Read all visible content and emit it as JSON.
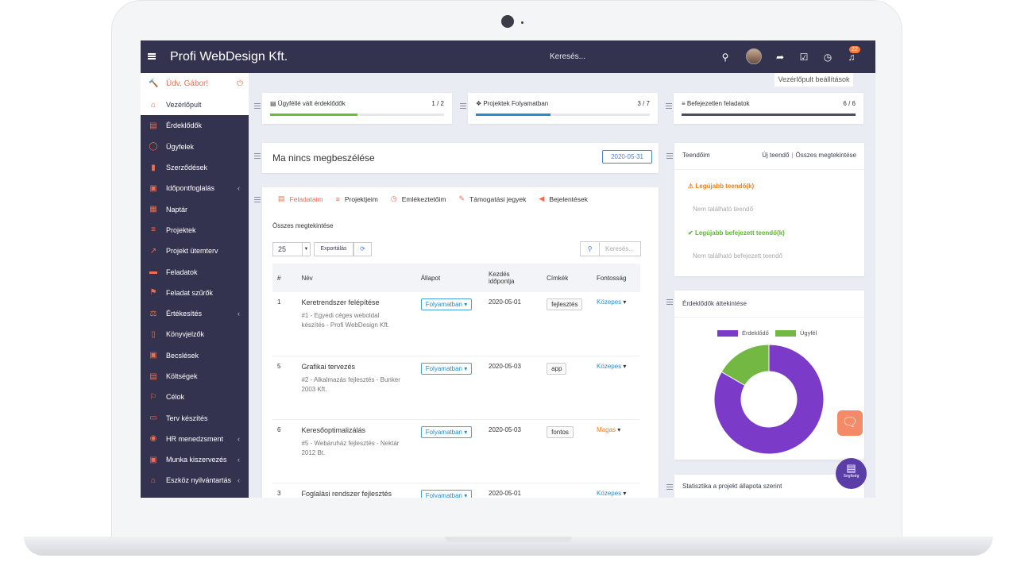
{
  "header": {
    "brand": "Profi WebDesign Kft.",
    "search_placeholder": "Keresés...",
    "notification_count": "22"
  },
  "sidebar": {
    "welcome": "Üdv, Gábor!",
    "items": [
      {
        "label": "Vezérlőpult",
        "icon": "home-icon",
        "glyph": "⌂",
        "active": true,
        "caret": false
      },
      {
        "label": "Érdeklődők",
        "icon": "store-icon",
        "glyph": "▤",
        "caret": false
      },
      {
        "label": "Ügyfelek",
        "icon": "user-icon",
        "glyph": "◯",
        "caret": false
      },
      {
        "label": "Szerződések",
        "icon": "document-icon",
        "glyph": "▮",
        "caret": false
      },
      {
        "label": "Időpontfoglalás",
        "icon": "calendar-check-icon",
        "glyph": "▣",
        "caret": true
      },
      {
        "label": "Naptár",
        "icon": "calendar-icon",
        "glyph": "▦",
        "caret": false
      },
      {
        "label": "Projektek",
        "icon": "list-icon",
        "glyph": "≡",
        "caret": false
      },
      {
        "label": "Projekt ütemterv",
        "icon": "line-chart-icon",
        "glyph": "↗",
        "caret": false
      },
      {
        "label": "Feladatok",
        "icon": "tasks-icon",
        "glyph": "▬",
        "caret": false
      },
      {
        "label": "Feladat szűrők",
        "icon": "filter-flag-icon",
        "glyph": "⚑",
        "caret": false
      },
      {
        "label": "Értékesítés",
        "icon": "balance-scale-icon",
        "glyph": "⚖",
        "caret": true
      },
      {
        "label": "Könyvjelzők",
        "icon": "bookmark-icon",
        "glyph": "▯",
        "caret": false
      },
      {
        "label": "Becslések",
        "icon": "estimate-icon",
        "glyph": "▣",
        "caret": false
      },
      {
        "label": "Költségek",
        "icon": "receipt-icon",
        "glyph": "▤",
        "caret": false
      },
      {
        "label": "Célok",
        "icon": "flag-icon",
        "glyph": "⚐",
        "caret": false
      },
      {
        "label": "Terv készítés",
        "icon": "id-card-icon",
        "glyph": "▭",
        "caret": false
      },
      {
        "label": "HR menedzsment",
        "icon": "person-circle-icon",
        "glyph": "◉",
        "caret": true
      },
      {
        "label": "Munka kiszervezés",
        "icon": "calendar-plus-icon",
        "glyph": "▣",
        "caret": true
      },
      {
        "label": "Eszköz nyilvántartás",
        "icon": "bank-icon",
        "glyph": "⌂",
        "caret": true
      }
    ]
  },
  "dashboard_settings_label": "Vezérlőpult beállítások",
  "stats": [
    {
      "title": "Ügyféllé vált érdeklődők",
      "count": "1 / 2",
      "progress": 0.5,
      "color": "#6cbb3c"
    },
    {
      "title": "Projektek Folyamatban",
      "count": "3 / 7",
      "progress": 0.43,
      "color": "#2a8acb"
    },
    {
      "title": "Befejezetlen feladatok",
      "count": "6 / 6",
      "progress": 1.0,
      "color": "#4a4d5e"
    }
  ],
  "meetings": {
    "title": "Ma nincs megbeszélése",
    "date": "2020-05-31"
  },
  "tasks": {
    "tabs": [
      {
        "label": "Feladataim",
        "icon": "tasks-icon",
        "glyph": "▤",
        "active": true
      },
      {
        "label": "Projektjeim",
        "icon": "list-icon",
        "glyph": "≡",
        "active": false
      },
      {
        "label": "Emlékeztetőim",
        "icon": "clock-icon",
        "glyph": "◷",
        "active": false
      },
      {
        "label": "Támogatási jegyek",
        "icon": "ticket-icon",
        "glyph": "✎",
        "active": false
      },
      {
        "label": "Bejelentések",
        "icon": "megaphone-icon",
        "glyph": "◀",
        "active": false
      }
    ],
    "view_all": "Összes megtekintése",
    "page_size": "25",
    "export_label": "Exportálás",
    "search_placeholder": "Keresés...",
    "columns": [
      "#",
      "Név",
      "Állapot",
      "Kezdés időpontja",
      "Címkék",
      "Fontosság"
    ],
    "rows": [
      {
        "id": "1",
        "name": "Keretrendszer felépítése",
        "desc": "#1 - Egyedi céges weboldal készítés - Profi WebDesign Kft.",
        "status": "Folyamatban",
        "start": "2020-05-01",
        "tag": "fejlesztés",
        "priority": "Közepes",
        "priority_color": "#2a8acb"
      },
      {
        "id": "5",
        "name": "Grafikai tervezés",
        "desc": "#2 - Alkalmazás fejlesztés - Bunker 2003 Kft.",
        "status": "Folyamatban",
        "start": "2020-05-03",
        "tag": "app",
        "priority": "Közepes",
        "priority_color": "#2a8acb"
      },
      {
        "id": "6",
        "name": "Keresőoptimalizálás",
        "desc": "#5 - Webáruház fejlesztés - Nektár 2012 Bt.",
        "status": "Folyamatban",
        "start": "2020-05-03",
        "tag": "fontos",
        "priority": "Magas",
        "priority_color": "#f07f1e"
      },
      {
        "id": "3",
        "name": "Foglalási rendszer fejlesztés",
        "desc": "",
        "status": "Folyamatban",
        "start": "2020-05-01",
        "tag": "",
        "priority": "Közepes",
        "priority_color": "#2a8acb"
      }
    ]
  },
  "todos": {
    "title": "Teendőim",
    "new_label": "Új teendő",
    "view_all": "Összes megtekintése",
    "latest_title": "Legújabb teendő(k)",
    "latest_empty": "Nem található teendő",
    "done_title": "Legújabb befejezett teendő(k)",
    "done_empty": "Nem található befejezett teendő"
  },
  "leads_overview": {
    "title": "Érdeklődők áttekintése"
  },
  "chart_data": {
    "type": "pie",
    "donut": true,
    "categories": [
      "Érdeklődő",
      "Ügyfél"
    ],
    "values": [
      1,
      0.2
    ],
    "colors": [
      "#7c3ac9",
      "#72b843"
    ],
    "legend_position": "top"
  },
  "project_stats": {
    "title": "Statisztika a projekt állapota szerint"
  },
  "help_label": "Segítség"
}
